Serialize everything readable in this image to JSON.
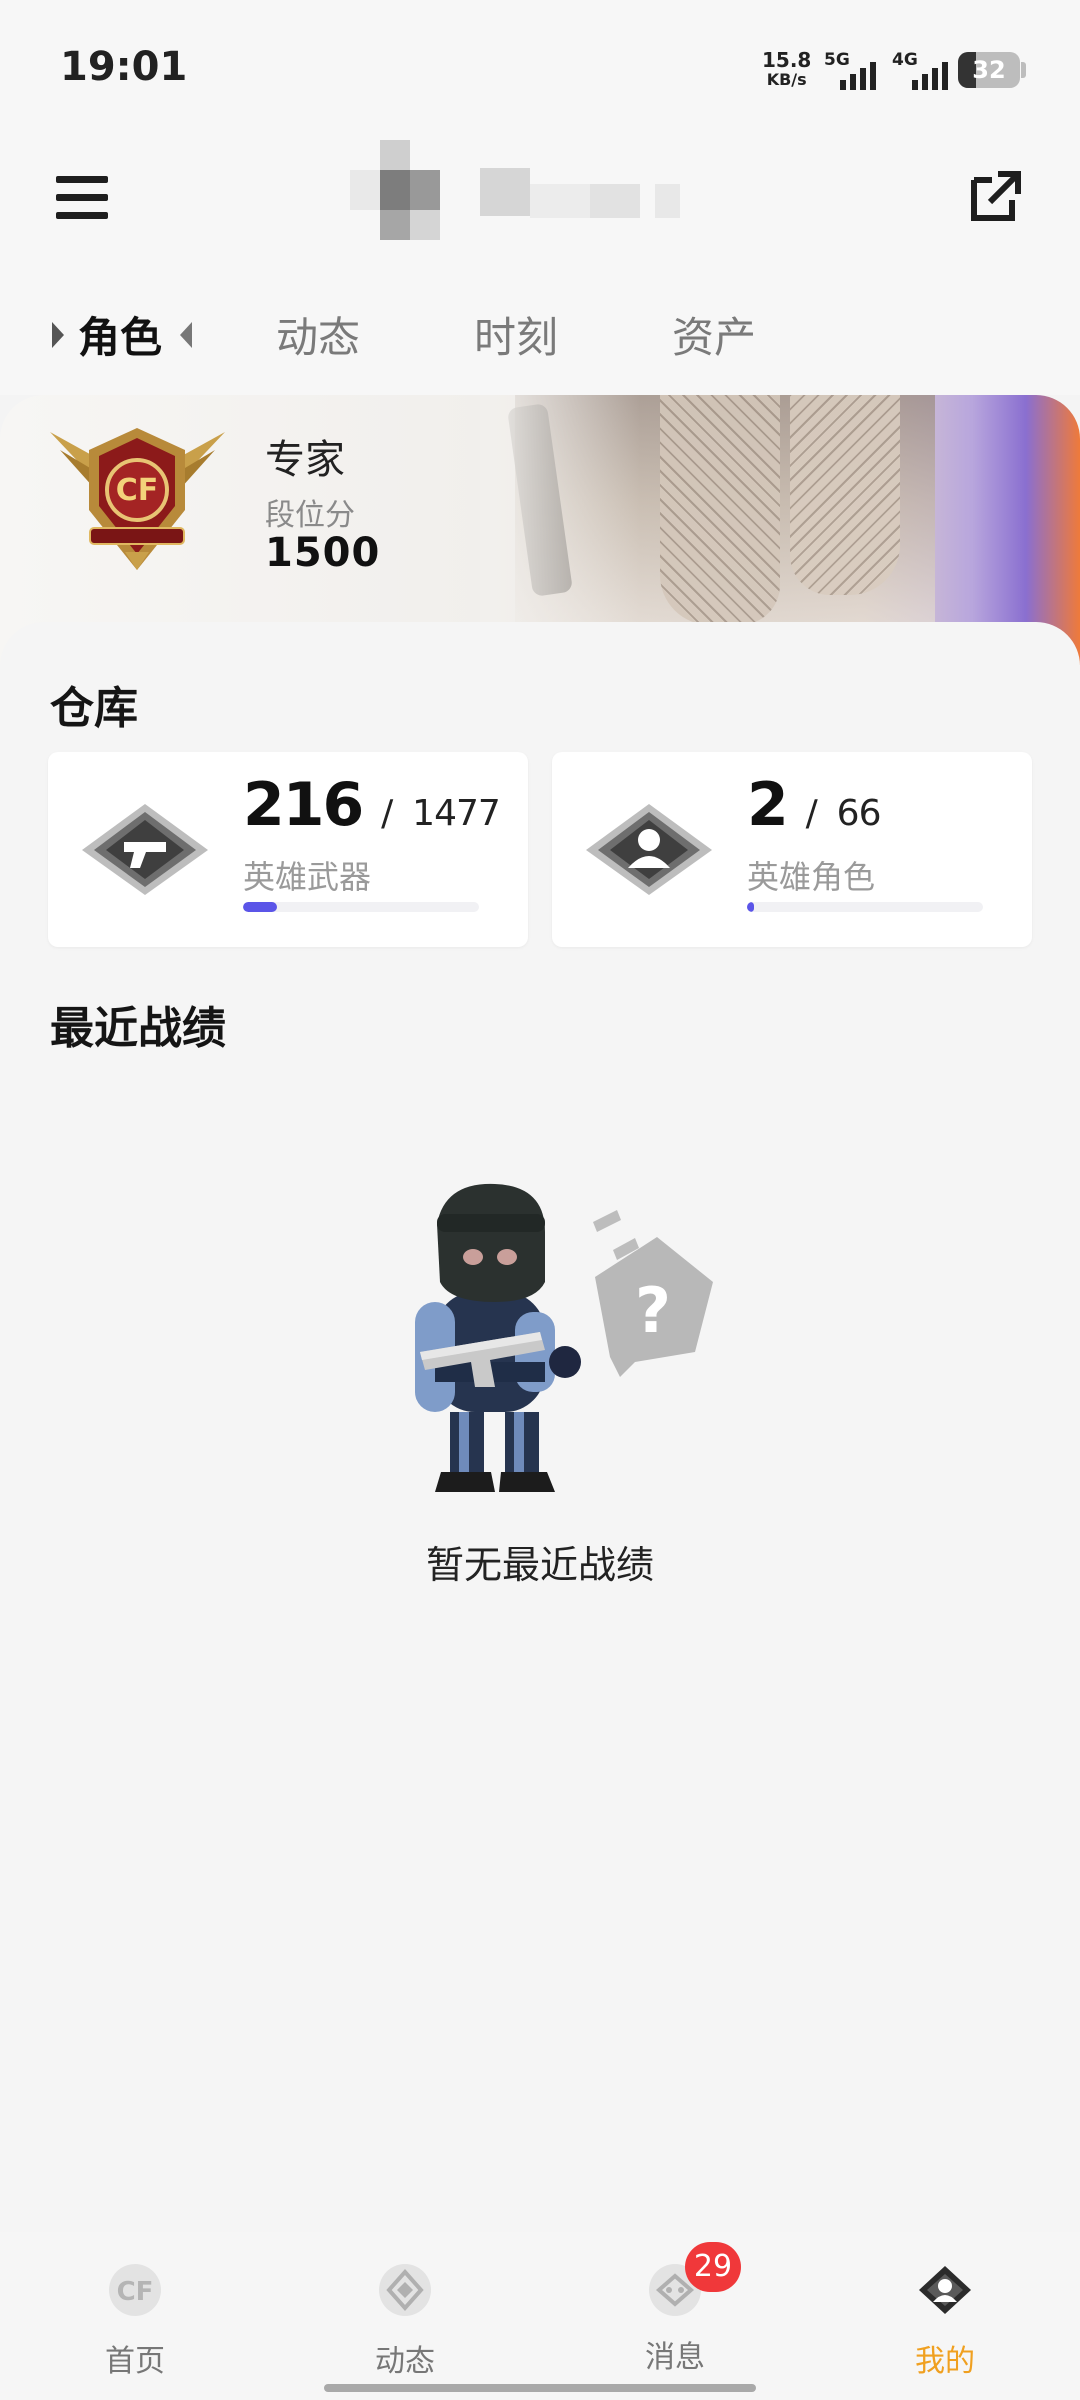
{
  "status_bar": {
    "time": "19:01",
    "net_speed_value": "15.8",
    "net_speed_unit": "KB/s",
    "sim1_label": "5G",
    "sim2_label": "4G",
    "battery_level": "32"
  },
  "header": {
    "menu_icon": "hamburger-menu-icon",
    "share_icon": "external-share-icon"
  },
  "tabs": [
    {
      "label": "角色",
      "active": true
    },
    {
      "label": "动态",
      "active": false
    },
    {
      "label": "时刻",
      "active": false
    },
    {
      "label": "资产",
      "active": false
    }
  ],
  "rank": {
    "title": "专家",
    "score_label": "段位分",
    "score": "1500"
  },
  "warehouse": {
    "title": "仓库",
    "cards": [
      {
        "count": "216",
        "separator": "/",
        "total": "1477",
        "label": "英雄武器",
        "progress": 0.146,
        "icon": "hero-weapon-icon"
      },
      {
        "count": "2",
        "separator": "/",
        "total": "66",
        "label": "英雄角色",
        "progress": 0.03,
        "icon": "hero-character-icon"
      }
    ]
  },
  "recent": {
    "title": "最近战绩",
    "empty_text": "暂无最近战绩"
  },
  "bottom_nav": {
    "items": [
      {
        "label": "首页",
        "icon": "cf-home-icon"
      },
      {
        "label": "动态",
        "icon": "feed-diamond-icon"
      },
      {
        "label": "消息",
        "icon": "message-icon",
        "badge": "29"
      },
      {
        "label": "我的",
        "icon": "profile-icon",
        "active": true
      }
    ]
  },
  "colors": {
    "accent": "#5b55e8",
    "active_nav": "#f0a020",
    "badge": "#f0383a"
  }
}
